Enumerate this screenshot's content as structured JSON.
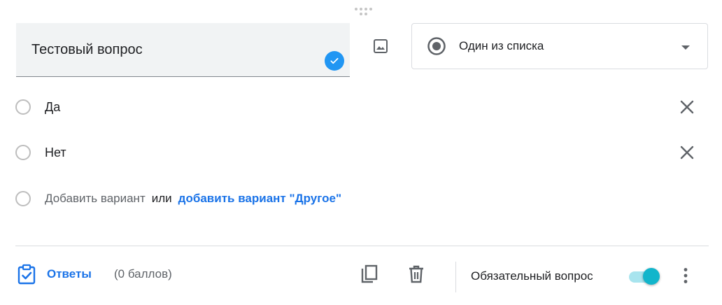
{
  "question": {
    "title": "Тестовый вопрос"
  },
  "question_type": {
    "selected": "Один из списка"
  },
  "options": [
    {
      "label": "Да"
    },
    {
      "label": "Нет"
    }
  ],
  "add_option": {
    "placeholder": "Добавить вариант",
    "or_text": "или",
    "add_other_link": "добавить вариант \"Другое\""
  },
  "footer": {
    "answers_label": "Ответы",
    "points": "(0 баллов)",
    "required_label": "Обязательный вопрос",
    "required_on": true
  },
  "colors": {
    "accent_blue": "#1a73e8",
    "check_badge": "#2196f3",
    "toggle_thumb": "#12b5cb",
    "toggle_track": "#a8e4ee"
  },
  "icons": [
    "drag-handle-icon",
    "checkmark-icon",
    "image-icon",
    "radio-button-icon",
    "dropdown-arrow-icon",
    "close-icon",
    "answer-key-icon",
    "copy-icon",
    "trash-icon",
    "more-vert-icon"
  ]
}
